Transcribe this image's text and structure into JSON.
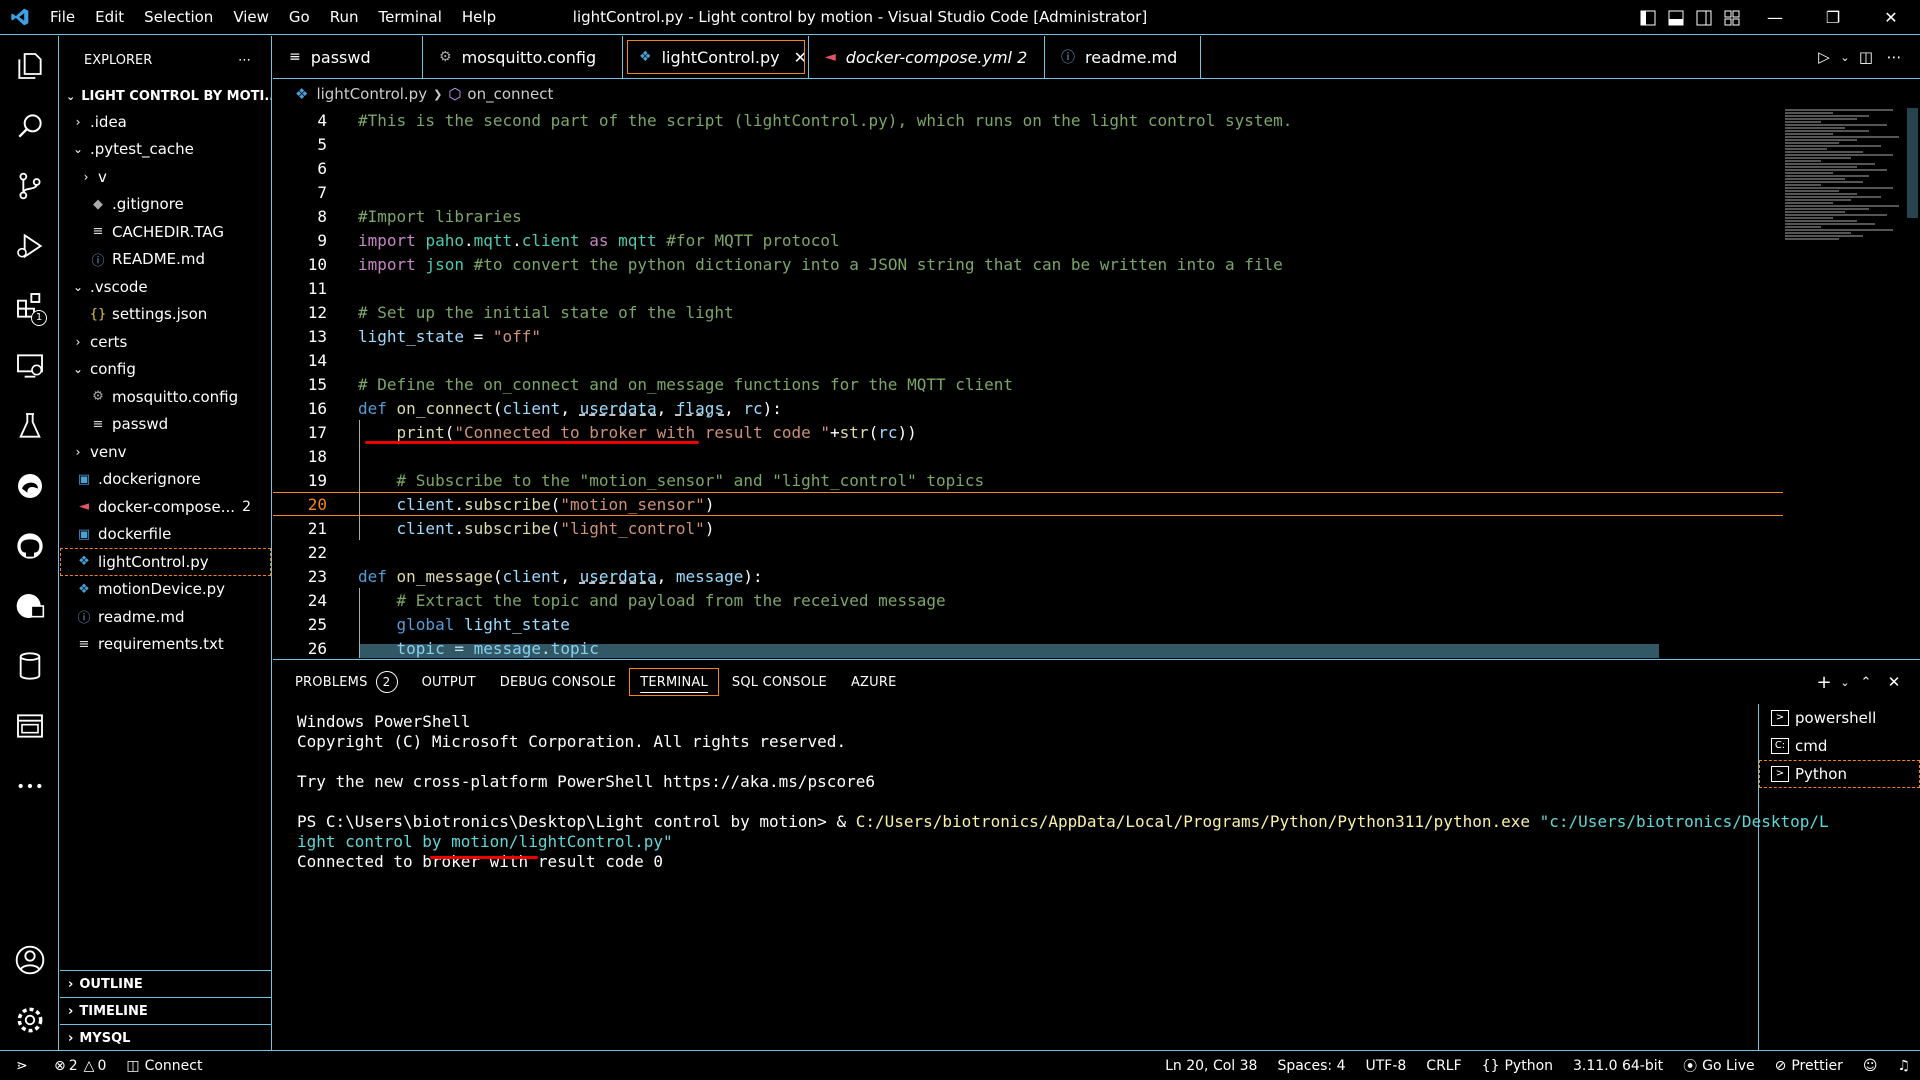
{
  "titlebar": {
    "menu": [
      "File",
      "Edit",
      "Selection",
      "View",
      "Go",
      "Run",
      "Terminal",
      "Help"
    ],
    "title": "lightControl.py - Light control by motion - Visual Studio Code [Administrator]"
  },
  "activity": {
    "extensions_badge": "1"
  },
  "explorer": {
    "header": "EXPLORER",
    "folder": "LIGHT CONTROL BY MOTI...",
    "items": [
      {
        "label": ".idea",
        "kind": "folder",
        "depth": 1,
        "open": false
      },
      {
        "label": ".pytest_cache",
        "kind": "folder",
        "depth": 1,
        "open": true
      },
      {
        "label": "v",
        "kind": "folder",
        "depth": 2,
        "open": false
      },
      {
        "label": ".gitignore",
        "kind": "file",
        "depth": 2,
        "icon": "git-icon"
      },
      {
        "label": "CACHEDIR.TAG",
        "kind": "file",
        "depth": 2,
        "icon": "text-file-icon"
      },
      {
        "label": "README.md",
        "kind": "file",
        "depth": 2,
        "icon": "info-icon"
      },
      {
        "label": ".vscode",
        "kind": "folder",
        "depth": 1,
        "open": true
      },
      {
        "label": "settings.json",
        "kind": "file",
        "depth": 2,
        "icon": "json-icon"
      },
      {
        "label": "certs",
        "kind": "folder",
        "depth": 1,
        "open": false
      },
      {
        "label": "config",
        "kind": "folder",
        "depth": 1,
        "open": true
      },
      {
        "label": "mosquitto.config",
        "kind": "file",
        "depth": 2,
        "icon": "gear-icon"
      },
      {
        "label": "passwd",
        "kind": "file",
        "depth": 2,
        "icon": "text-file-icon"
      },
      {
        "label": "venv",
        "kind": "folder",
        "depth": 1,
        "open": false
      },
      {
        "label": ".dockerignore",
        "kind": "file",
        "depth": 1,
        "icon": "docker-icon"
      },
      {
        "label": "docker-compose...",
        "kind": "file",
        "depth": 1,
        "icon": "docker-compose-icon",
        "count": "2",
        "error": true
      },
      {
        "label": "dockerfile",
        "kind": "file",
        "depth": 1,
        "icon": "docker-icon"
      },
      {
        "label": "lightControl.py",
        "kind": "file",
        "depth": 1,
        "icon": "python-icon",
        "selected": true
      },
      {
        "label": "motionDevice.py",
        "kind": "file",
        "depth": 1,
        "icon": "python-icon"
      },
      {
        "label": "readme.md",
        "kind": "file",
        "depth": 1,
        "icon": "info-icon"
      },
      {
        "label": "requirements.txt",
        "kind": "file",
        "depth": 1,
        "icon": "text-file-icon"
      }
    ],
    "sections": [
      "OUTLINE",
      "TIMELINE",
      "MYSQL"
    ]
  },
  "tabs": [
    {
      "label": "passwd",
      "icon": "text-file-icon"
    },
    {
      "label": "mosquitto.config",
      "icon": "gear-icon"
    },
    {
      "label": "lightControl.py",
      "icon": "python-icon",
      "active": true
    },
    {
      "label": "docker-compose.yml 2",
      "icon": "docker-compose-icon",
      "italic": true
    },
    {
      "label": "readme.md",
      "icon": "info-icon"
    }
  ],
  "breadcrumb": {
    "file": "lightControl.py",
    "symbol": "on_connect"
  },
  "editor": {
    "current_line": 20,
    "line_numbers": [
      "4",
      "5",
      "6",
      "7",
      "8",
      "9",
      "10",
      "11",
      "12",
      "13",
      "14",
      "15",
      "16",
      "17",
      "18",
      "19",
      "20",
      "21",
      "22",
      "23",
      "24",
      "25",
      "26"
    ]
  },
  "panel": {
    "tabs": [
      "PROBLEMS",
      "OUTPUT",
      "DEBUG CONSOLE",
      "TERMINAL",
      "SQL CONSOLE",
      "AZURE"
    ],
    "problems_count": "2",
    "active_tab": "TERMINAL",
    "terminal": {
      "line1": "Windows PowerShell",
      "line2": "Copyright (C) Microsoft Corporation. All rights reserved.",
      "line3": "Try the new cross-platform PowerShell https://aka.ms/pscore6",
      "prompt": "PS C:\\Users\\biotronics\\Desktop\\Light control by motion> & ",
      "exe": "C:/Users/biotronics/AppData/Local/Programs/Python/Python311/python.exe",
      "script_a": "\"c:/Users/biotronics/Desktop/L",
      "script_b": "ight control by motion/lightControl.py\"",
      "output": "Connected to broker with result code 0"
    },
    "terminals": [
      "powershell",
      "cmd",
      "Python"
    ]
  },
  "status": {
    "errors": "2",
    "warnings": "0",
    "connect": "Connect",
    "position": "Ln 20, Col 38",
    "spaces": "Spaces: 4",
    "encoding": "UTF-8",
    "eol": "CRLF",
    "language": "Python",
    "interpreter": "3.11.0 64-bit",
    "golive": "Go Live",
    "prettier": "Prettier"
  }
}
